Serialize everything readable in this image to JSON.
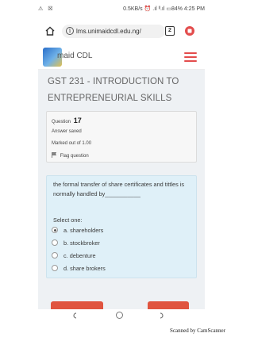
{
  "status_bar": {
    "left_icons": "⚠ ☒",
    "right_text": "0.5KB/s ⏰ .ıl ᴵᴵ.ıl ▭84% 4:25 PM"
  },
  "browser": {
    "url": "lms.unimaidcdl.edu.ng/",
    "tab_count": "2"
  },
  "header": {
    "logo_text": "maid CDL"
  },
  "course": {
    "title": "GST 231 - INTRODUCTION TO ENTREPRENEURIAL SKILLS"
  },
  "question_info": {
    "question_label": "Question",
    "question_number": "17",
    "status": "Answer saved",
    "marked": "Marked out of 1.00",
    "flag_label": "Flag question"
  },
  "question": {
    "text": "the formal transfer of share certificates and tittles is normally handled by___________",
    "select_label": "Select one:",
    "options": [
      {
        "label": "a. shareholders",
        "checked": true
      },
      {
        "label": "b. stockbroker",
        "checked": false
      },
      {
        "label": "c. debenture",
        "checked": false
      },
      {
        "label": "d. share brokers",
        "checked": false
      }
    ]
  },
  "colors": {
    "accent": "#e0543f",
    "question_bg": "#dff0f8",
    "page_bg": "#eef1f4"
  },
  "watermark": "Scanned by CamScanner"
}
